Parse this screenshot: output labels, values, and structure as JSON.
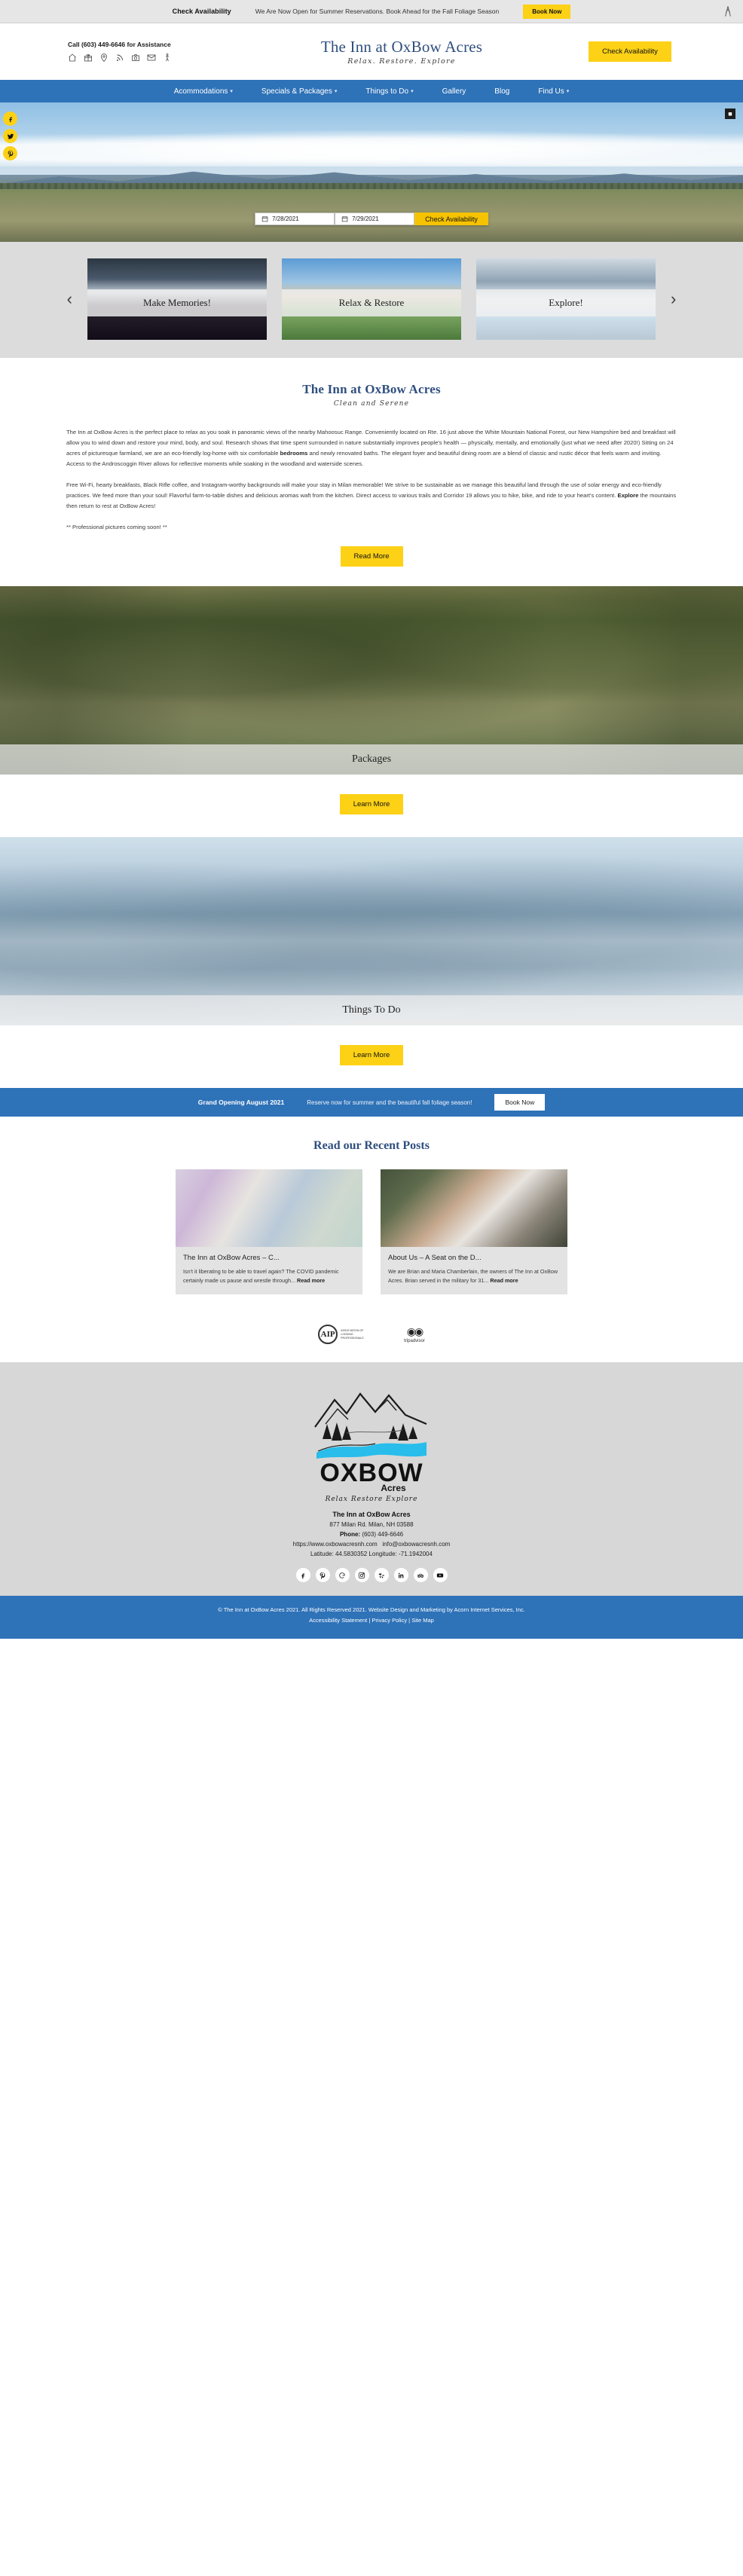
{
  "promo": {
    "link_label": "Check Availability",
    "message": "We Are Now Open for Summer Reservations. Book Ahead for the Fall Foliage Season",
    "book_label": "Book Now",
    "logo_icon": "acorn-logo-icon"
  },
  "header": {
    "phone_text": "Call (603) 449-6646 for Assistance",
    "brand_title": "The Inn at OxBow Acres",
    "brand_tagline": "Relax. Restore. Explore",
    "check_availability_label": "Check Availability",
    "util_icons": [
      {
        "name": "home-icon",
        "label": "Home"
      },
      {
        "name": "gift-icon",
        "label": "Gift Certificates"
      },
      {
        "name": "map-pin-icon",
        "label": "Location"
      },
      {
        "name": "rss-icon",
        "label": "Blog Feed"
      },
      {
        "name": "camera-icon",
        "label": "Gallery"
      },
      {
        "name": "mail-icon",
        "label": "Contact"
      },
      {
        "name": "accessibility-icon",
        "label": "Accessibility"
      }
    ]
  },
  "nav": {
    "items": [
      {
        "label": "Acommodations",
        "has_dropdown": true
      },
      {
        "label": "Specials & Packages",
        "has_dropdown": true
      },
      {
        "label": "Things to Do",
        "has_dropdown": true
      },
      {
        "label": "Gallery",
        "has_dropdown": false
      },
      {
        "label": "Blog",
        "has_dropdown": false
      },
      {
        "label": "Find Us",
        "has_dropdown": true
      }
    ],
    "accent_color": "#2e72b8"
  },
  "hero": {
    "social": [
      {
        "name": "facebook-icon",
        "label": "Facebook"
      },
      {
        "name": "twitter-icon",
        "label": "Twitter"
      },
      {
        "name": "pinterest-icon",
        "label": "Pinterest"
      }
    ],
    "expand_label": "■",
    "checkin_value": "7/28/2021",
    "checkout_value": "7/29/2021",
    "check_button_label": "Check Availability"
  },
  "carousel": {
    "prev_label": "‹",
    "next_label": "›",
    "cards": [
      {
        "label": "Make Memories!"
      },
      {
        "label": "Relax & Restore"
      },
      {
        "label": "Explore!"
      }
    ]
  },
  "intro": {
    "title": "The Inn at OxBow Acres",
    "subtitle": "Clean and Serene",
    "paragraph_1_a": "The Inn at OxBow Acres is the perfect place to relax as you soak in panoramic views of the nearby Mahoosuc Range. Conveniently located on Rte. 16 just above the White Mountain National Forest, our New Hampshire bed and breakfast will allow you to wind down and restore your mind, body, and soul. Research shows that time spent surrounded in nature substantially improves people's health — physically, mentally, and emotionally (just what we need after 2020!) Sitting on 24 acres of picturesque farmland, we are an eco-friendly log-home with six comfortable ",
    "paragraph_1_bold": "bedrooms",
    "paragraph_1_b": " and newly renovated baths. The elegant foyer and beautiful dining room are a blend of classic and rustic décor that feels warm and inviting. Access to the Androscoggin River allows for reflective moments while soaking in the woodland and waterside scenes.",
    "paragraph_2_a": "Free Wi-Fi, hearty breakfasts, Black Rifle coffee, and Instagram-worthy backgrounds will make your stay in Milan memorable! We strive to be sustainable as we manage this beautiful land through the use of solar energy and eco-friendly practices. We feed more than your soul! Flavorful farm-to-table dishes and delicious aromas waft from the kitchen. Direct access to various trails and Corridor 19 allows you to hike, bike, and ride to your heart's content. ",
    "paragraph_2_bold": "Explore",
    "paragraph_2_b": " the mountains then return to rest at OxBow Acres!",
    "paragraph_3": "** Professional pictures coming soon! **",
    "read_more_label": "Read More"
  },
  "banners": [
    {
      "caption": "Packages",
      "cta_label": "Learn More"
    },
    {
      "caption": "Things To Do",
      "cta_label": "Learn More"
    }
  ],
  "cta_bar": {
    "headline": "Grand Opening August 2021",
    "text": "Reserve now for summer and the beautiful fall foliage season!",
    "button_label": "Book Now"
  },
  "blog": {
    "title": "Read our Recent Posts",
    "posts": [
      {
        "title": "The Inn at OxBow Acres – C...",
        "excerpt": "Isn't it liberating to be able to travel again? The COVID pandemic certainly made us pause and wrestle through... ",
        "read_more": "Read more",
        "image": "cleaning-supplies-photo"
      },
      {
        "title": "About Us – A Seat on the D...",
        "excerpt": "We are Brian and Maria Chamberlain, the owners of The Inn at OxBow Acres. Brian served in the military for 31... ",
        "read_more": "Read more",
        "image": "innkeepers-photo"
      }
    ]
  },
  "badges": [
    {
      "name": "aip-badge",
      "initials": "AIP",
      "caption": "ASSOCIATION OF LODGING PROFESSIONALS"
    },
    {
      "name": "tripadvisor-badge",
      "caption": "tripadvisor"
    }
  ],
  "footer": {
    "logo_word": "OXBOW",
    "logo_acres": "Acres",
    "logo_tagline": "Relax  Restore  Explore",
    "business_name": "The Inn at OxBow Acres",
    "address": "877 Milan Rd. Milan, NH 03588",
    "phone_label": "Phone:",
    "phone_value": "(603) 449-6646",
    "website": "https://www.oxbowacresnh.com",
    "email": "info@oxbowacresnh.com",
    "coords": "Latitude: 44.5830352 Longitude: -71.1942004",
    "socials": [
      {
        "name": "facebook-icon",
        "label": "Facebook"
      },
      {
        "name": "pinterest-icon",
        "label": "Pinterest"
      },
      {
        "name": "google-icon",
        "label": "Google"
      },
      {
        "name": "instagram-icon",
        "label": "Instagram"
      },
      {
        "name": "yelp-icon",
        "label": "Yelp"
      },
      {
        "name": "linkedin-icon",
        "label": "LinkedIn"
      },
      {
        "name": "tripadvisor-icon",
        "label": "TripAdvisor"
      },
      {
        "name": "youtube-icon",
        "label": "YouTube"
      }
    ],
    "copyright": "© The Inn at OxBow Acres 2021. All Rights Reserved 2021. Website Design and Marketing by Acorn Internet Services, Inc.",
    "link_accessibility": "Accessibility Statement",
    "link_privacy": "Privacy Policy",
    "link_sitemap": "Site Map",
    "sep": " | "
  },
  "colors": {
    "brand_blue": "#2e72b8",
    "heading_blue": "#2f4f7f",
    "accent_yellow": "#fcd116"
  }
}
